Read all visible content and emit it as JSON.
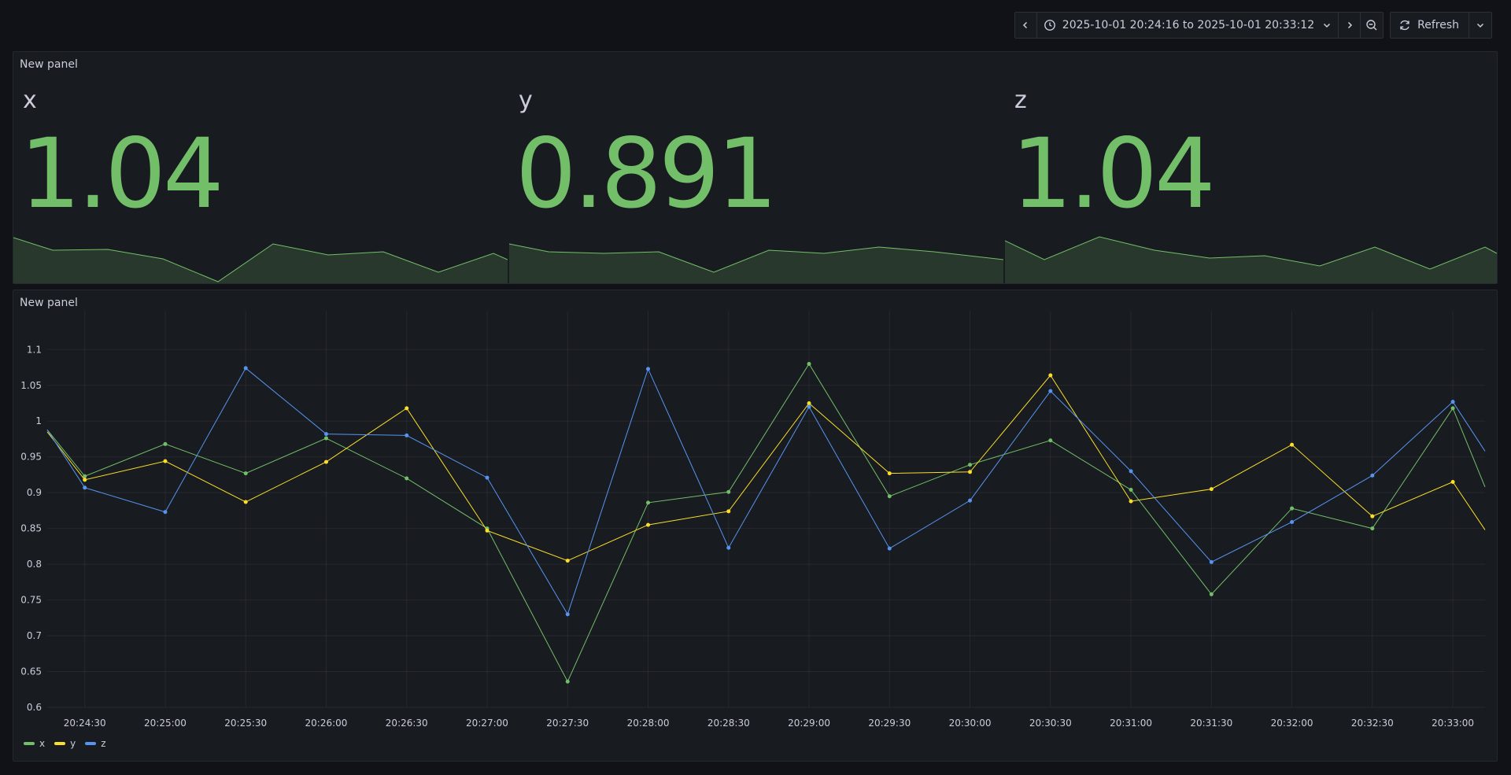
{
  "toolbar": {
    "time_range": "2025-10-01 20:24:16 to 2025-10-01 20:33:12",
    "refresh_label": "Refresh",
    "icons": {
      "back": "chevron-left-icon",
      "clock": "clock-icon",
      "range_caret": "chevron-down-icon",
      "forward": "chevron-right-icon",
      "zoom_out": "zoom-out-icon",
      "refresh": "refresh-icon",
      "refresh_caret": "chevron-down-icon"
    }
  },
  "colors": {
    "x": "#73bf69",
    "y": "#fade2a",
    "z": "#5794f2",
    "background": "#111217",
    "panel": "#181b1f"
  },
  "stat_panel": {
    "title": "New panel",
    "stats": [
      {
        "name": "x",
        "value": "1.04"
      },
      {
        "name": "y",
        "value": "0.891"
      },
      {
        "name": "z",
        "value": "1.04"
      }
    ]
  },
  "timeseries_panel": {
    "title": "New panel",
    "legend": [
      {
        "name": "x"
      },
      {
        "name": "y"
      },
      {
        "name": "z"
      }
    ]
  },
  "chart_data": {
    "type": "line",
    "x_ticks": [
      "20:24:30",
      "20:25:00",
      "20:25:30",
      "20:26:00",
      "20:26:30",
      "20:27:00",
      "20:27:30",
      "20:28:00",
      "20:28:30",
      "20:29:00",
      "20:29:30",
      "20:30:00",
      "20:30:30",
      "20:31:00",
      "20:31:30",
      "20:32:00",
      "20:32:30",
      "20:33:00"
    ],
    "y_ticks": [
      "0.6",
      "0.65",
      "0.7",
      "0.75",
      "0.8",
      "0.85",
      "0.9",
      "0.95",
      "1",
      "1.05",
      "1.1"
    ],
    "ylim": [
      0.6,
      1.13
    ],
    "xlim": [
      "20:24:16",
      "20:33:12"
    ],
    "grid": true,
    "legend_position": "bottom-left",
    "x": [
      "20:24:16",
      "20:24:30",
      "20:25:00",
      "20:25:30",
      "20:26:00",
      "20:26:30",
      "20:27:00",
      "20:27:30",
      "20:28:00",
      "20:28:30",
      "20:29:00",
      "20:29:30",
      "20:30:00",
      "20:30:30",
      "20:31:00",
      "20:31:30",
      "20:32:00",
      "20:32:30",
      "20:33:00",
      "20:33:12"
    ],
    "series": [
      {
        "name": "x",
        "values": [
          0.988,
          0.923,
          0.968,
          0.927,
          0.976,
          0.92,
          0.85,
          0.636,
          0.886,
          0.901,
          1.08,
          0.895,
          0.939,
          0.973,
          0.904,
          0.758,
          0.878,
          0.85,
          1.018,
          0.908
        ]
      },
      {
        "name": "y",
        "values": [
          0.985,
          0.918,
          0.944,
          0.887,
          0.943,
          1.018,
          0.847,
          0.805,
          0.855,
          0.874,
          1.025,
          0.927,
          0.929,
          1.064,
          0.888,
          0.905,
          0.967,
          0.867,
          0.915,
          0.848
        ]
      },
      {
        "name": "z",
        "values": [
          0.988,
          0.907,
          0.873,
          1.074,
          0.982,
          0.98,
          0.921,
          0.73,
          1.073,
          0.823,
          1.02,
          0.822,
          0.889,
          1.042,
          0.93,
          0.803,
          0.859,
          0.924,
          1.027,
          0.958
        ]
      }
    ]
  }
}
